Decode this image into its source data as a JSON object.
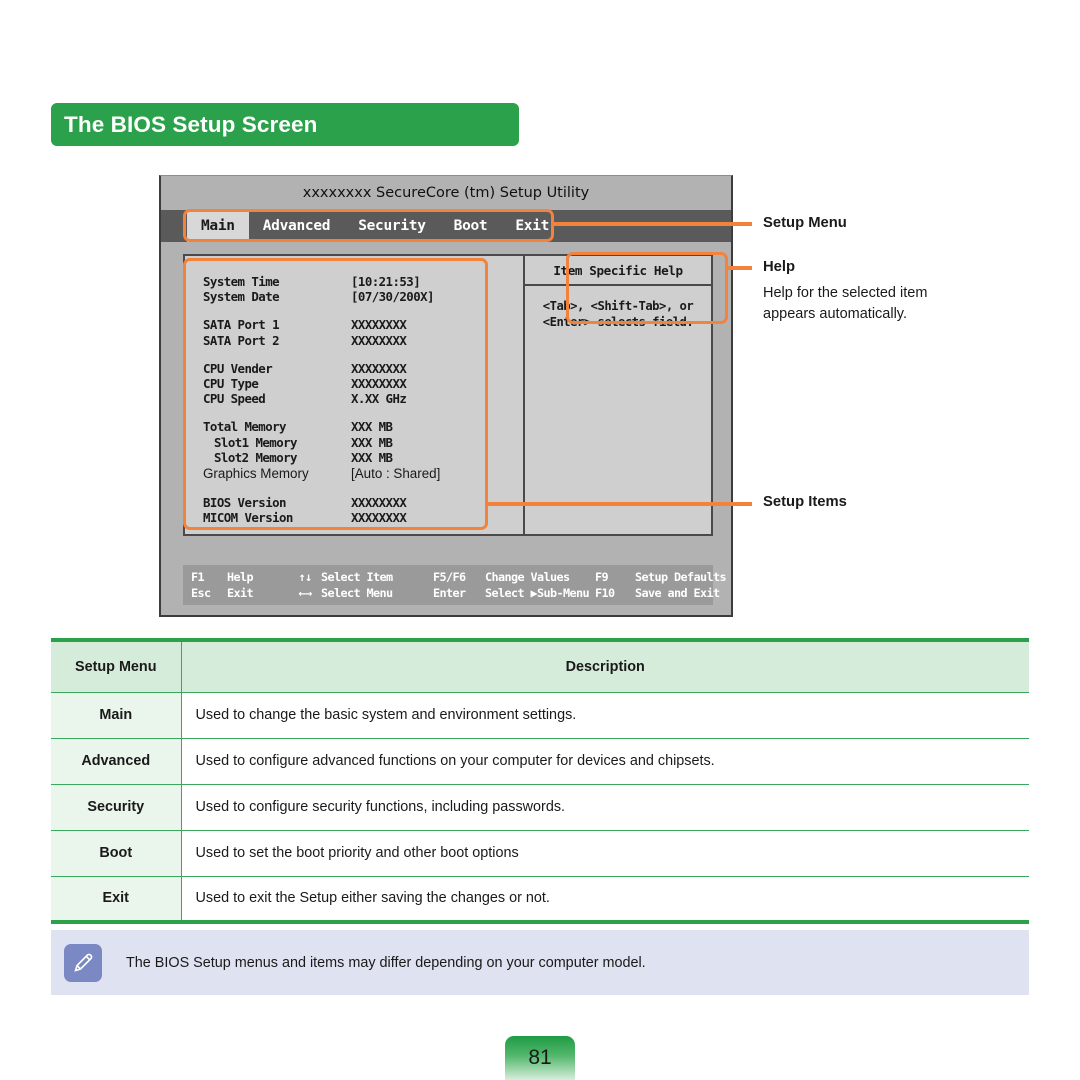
{
  "section": {
    "title": "The BIOS Setup Screen"
  },
  "bios": {
    "title": "xxxxxxxx SecureCore (tm) Setup Utility",
    "tabs": [
      {
        "label": "Main",
        "active": true
      },
      {
        "label": "Advanced",
        "active": false
      },
      {
        "label": "Security",
        "active": false
      },
      {
        "label": "Boot",
        "active": false
      },
      {
        "label": "Exit",
        "active": false
      }
    ],
    "items": [
      {
        "label": "System Time",
        "value": "[10:21:53]",
        "style": "bios"
      },
      {
        "label": "System Date",
        "value": "[07/30/200X]",
        "style": "bios"
      },
      {
        "gap": true
      },
      {
        "label": "SATA Port 1",
        "value": "XXXXXXXX",
        "style": "bios"
      },
      {
        "label": "SATA Port 2",
        "value": "XXXXXXXX",
        "style": "bios"
      },
      {
        "gap": true
      },
      {
        "label": "CPU Vender",
        "value": "XXXXXXXX",
        "style": "bios"
      },
      {
        "label": "CPU Type",
        "value": "XXXXXXXX",
        "style": "bios"
      },
      {
        "label": "CPU Speed",
        "value": "X.XX GHz",
        "style": "bios"
      },
      {
        "gap": true
      },
      {
        "label": "Total Memory",
        "value": "XXX MB",
        "style": "bios"
      },
      {
        "label": "Slot1 Memory",
        "value": "XXX MB",
        "style": "bios",
        "indent": true
      },
      {
        "label": "Slot2 Memory",
        "value": "XXX MB",
        "style": "bios",
        "indent": true
      },
      {
        "label": "Graphics Memory",
        "value": "[Auto : Shared]",
        "style": "proportional"
      },
      {
        "gap": true
      },
      {
        "label": "BIOS Version",
        "value": "XXXXXXXX",
        "style": "bios"
      },
      {
        "label": "MICOM Version",
        "value": "XXXXXXXX",
        "style": "bios"
      }
    ],
    "help": {
      "title": "Item Specific Help",
      "line1": "<Tab>, <Shift-Tab>, or",
      "line2": "<Enter> selects field."
    },
    "keybar": [
      {
        "key": "F1",
        "action": "Help"
      },
      {
        "key": "Esc",
        "action": "Exit"
      },
      {
        "key": "↑↓",
        "action": "Select Item"
      },
      {
        "key": "←→",
        "action": "Select Menu"
      },
      {
        "key": "F5/F6",
        "action": "Change Values"
      },
      {
        "key": "Enter",
        "action": "Select ▶Sub-Menu"
      },
      {
        "key": "F9",
        "action": "Setup Defaults"
      },
      {
        "key": "F10",
        "action": "Save and Exit"
      }
    ]
  },
  "callouts": {
    "setup_menu": "Setup Menu",
    "help_label": "Help",
    "help_body": "Help for the selected item appears automatically.",
    "setup_items": "Setup Items"
  },
  "table": {
    "headers": [
      "Setup Menu",
      "Description"
    ],
    "rows": [
      {
        "menu": "Main",
        "description": "Used to change the basic system and environment settings."
      },
      {
        "menu": "Advanced",
        "description": "Used to configure advanced functions on your computer for devices and chipsets."
      },
      {
        "menu": "Security",
        "description": "Used to configure security functions, including passwords."
      },
      {
        "menu": "Boot",
        "description": "Used to set the boot priority and other boot options"
      },
      {
        "menu": "Exit",
        "description": "Used to exit the Setup either saving the changes or not."
      }
    ]
  },
  "note": {
    "text": "The BIOS Setup menus and items may differ depending on your computer model."
  },
  "page": {
    "number": "81"
  },
  "colors": {
    "brand_green": "#2aa14a",
    "highlight_orange": "#f2823c",
    "note_blue": "#dfe2f0",
    "note_icon_blue": "#7a88c4",
    "table_header_green": "#d6ecda",
    "table_cell_green": "#eaf5ec"
  }
}
